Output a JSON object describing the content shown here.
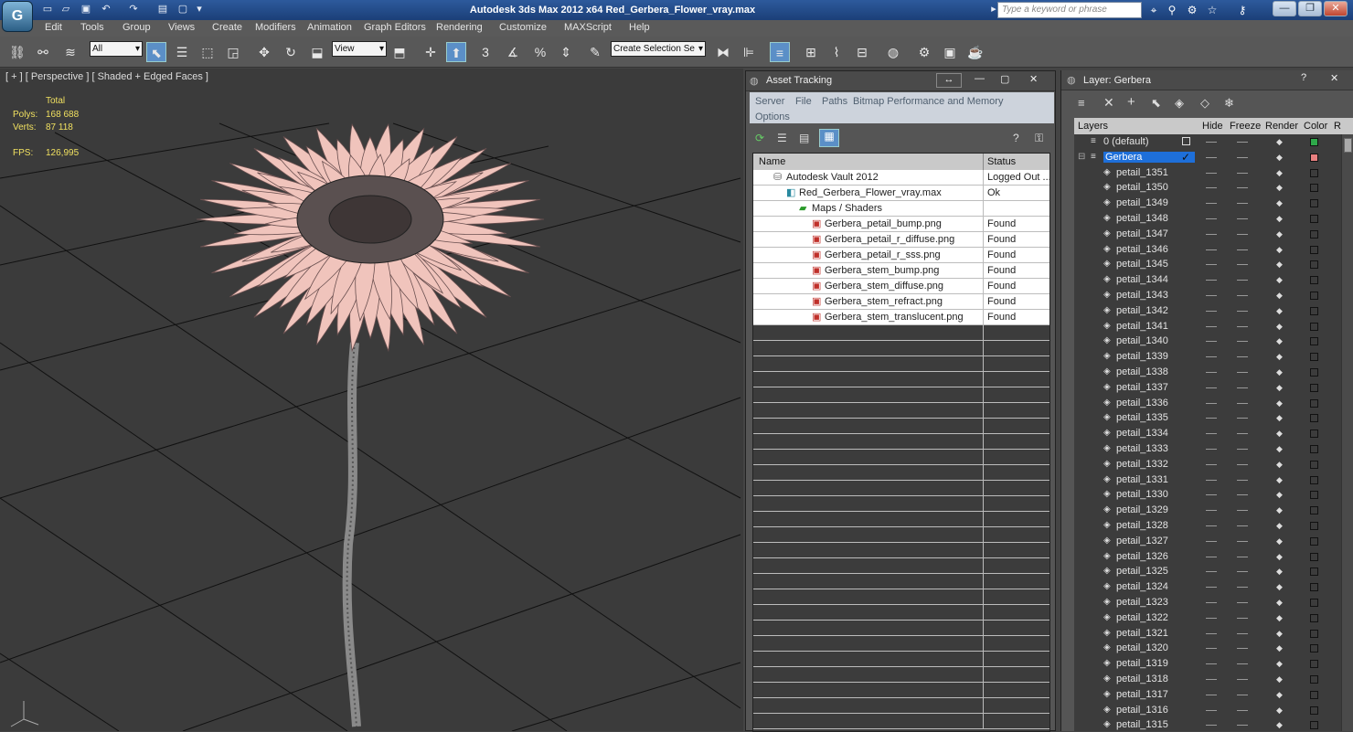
{
  "app": {
    "window_title": "Autodesk 3ds Max  2012 x64     Red_Gerbera_Flower_vray.max",
    "search_placeholder": "Type a keyword or phrase"
  },
  "menubar": [
    "Edit",
    "Tools",
    "Group",
    "Views",
    "Create",
    "Modifiers",
    "Animation",
    "Graph Editors",
    "Rendering",
    "Customize",
    "MAXScript",
    "Help"
  ],
  "toolbar": {
    "selection_filter": "All",
    "reference_coord": "View",
    "named_selection": "Create Selection Se",
    "snap_label": "3"
  },
  "viewport": {
    "label": "[ + ] [ Perspective ] [ Shaded + Edged Faces ]",
    "stats": {
      "total_label": "Total",
      "polys_label": "Polys:",
      "polys_value": "168 688",
      "verts_label": "Verts:",
      "verts_value": "87 118",
      "fps_label": "FPS:",
      "fps_value": "126,995"
    }
  },
  "asset_tracking": {
    "title": "Asset Tracking",
    "menu": [
      "Server",
      "File",
      "Paths",
      "Bitmap Performance and Memory",
      "Options"
    ],
    "columns": [
      "Name",
      "Status"
    ],
    "rows": [
      {
        "name": "Autodesk Vault 2012",
        "status": "Logged Out ...",
        "indent": 1,
        "icon": "vault-icon"
      },
      {
        "name": "Red_Gerbera_Flower_vray.max",
        "status": "Ok",
        "indent": 2,
        "icon": "max-file-icon"
      },
      {
        "name": "Maps / Shaders",
        "status": "",
        "indent": 3,
        "icon": "maps-folder-icon"
      },
      {
        "name": "Gerbera_petail_bump.png",
        "status": "Found",
        "indent": 4,
        "icon": "image-file-icon"
      },
      {
        "name": "Gerbera_petail_r_diffuse.png",
        "status": "Found",
        "indent": 4,
        "icon": "image-file-icon"
      },
      {
        "name": "Gerbera_petail_r_sss.png",
        "status": "Found",
        "indent": 4,
        "icon": "image-file-icon"
      },
      {
        "name": "Gerbera_stem_bump.png",
        "status": "Found",
        "indent": 4,
        "icon": "image-file-icon"
      },
      {
        "name": "Gerbera_stem_diffuse.png",
        "status": "Found",
        "indent": 4,
        "icon": "image-file-icon"
      },
      {
        "name": "Gerbera_stem_refract.png",
        "status": "Found",
        "indent": 4,
        "icon": "image-file-icon"
      },
      {
        "name": "Gerbera_stem_translucent.png",
        "status": "Found",
        "indent": 4,
        "icon": "image-file-icon"
      }
    ]
  },
  "layer_panel": {
    "title": "Layer: Gerbera",
    "columns": [
      "Layers",
      "Hide",
      "Freeze",
      "Render",
      "Color",
      "R"
    ],
    "layers": [
      {
        "name": "0 (default)",
        "color": "#2ea84a",
        "level": 0,
        "selected": false
      },
      {
        "name": "Gerbera",
        "color": "#e88080",
        "level": 0,
        "selected": true
      }
    ],
    "objects": [
      "petail_1351",
      "petail_1350",
      "petail_1349",
      "petail_1348",
      "petail_1347",
      "petail_1346",
      "petail_1345",
      "petail_1344",
      "petail_1343",
      "petail_1342",
      "petail_1341",
      "petail_1340",
      "petail_1339",
      "petail_1338",
      "petail_1337",
      "petail_1336",
      "petail_1335",
      "petail_1334",
      "petail_1333",
      "petail_1332",
      "petail_1331",
      "petail_1330",
      "petail_1329",
      "petail_1328",
      "petail_1327",
      "petail_1326",
      "petail_1325",
      "petail_1324",
      "petail_1323",
      "petail_1322",
      "petail_1321",
      "petail_1320",
      "petail_1319",
      "petail_1318",
      "petail_1317",
      "petail_1316",
      "petail_1315"
    ]
  },
  "colors": {
    "accent_selection": "#1e6fd9",
    "petal_color": "#f0c4bc",
    "stat_color": "#f0e060"
  }
}
